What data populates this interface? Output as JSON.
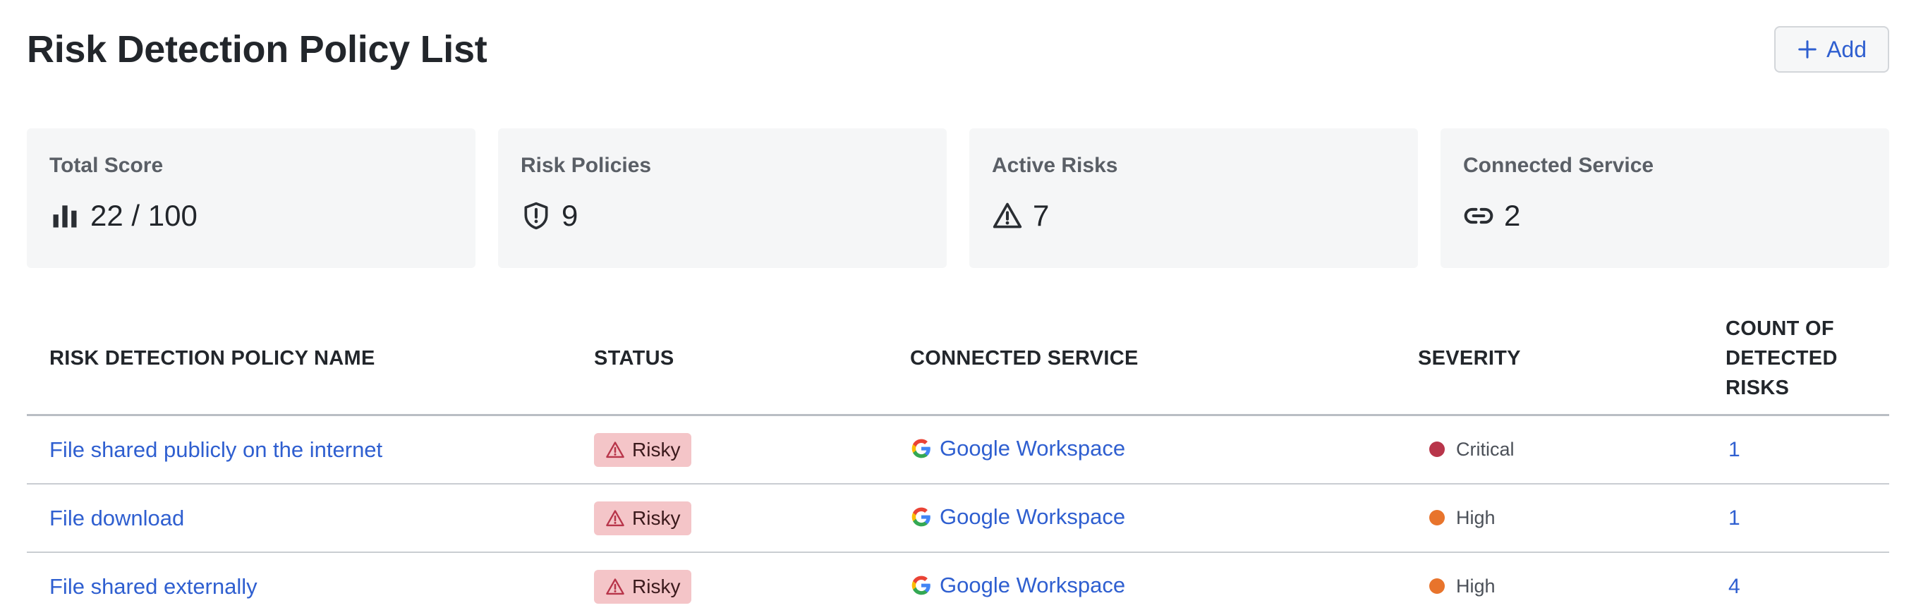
{
  "header": {
    "title": "Risk Detection Policy List",
    "add_label": "Add"
  },
  "cards": [
    {
      "label": "Total Score",
      "value": "22 / 100",
      "icon": "bar-chart-icon"
    },
    {
      "label": "Risk Policies",
      "value": "9",
      "icon": "shield-alert-icon"
    },
    {
      "label": "Active Risks",
      "value": "7",
      "icon": "warning-icon"
    },
    {
      "label": "Connected Service",
      "value": "2",
      "icon": "link-icon"
    }
  ],
  "table": {
    "columns": [
      "RISK DETECTION POLICY NAME",
      "STATUS",
      "CONNECTED SERVICE",
      "SEVERITY",
      "COUNT OF DETECTED RISKS"
    ],
    "rows": [
      {
        "name": "File shared publicly on the internet",
        "status": "Risky",
        "service": "Google Workspace",
        "severity": "Critical",
        "count": "1"
      },
      {
        "name": "File download",
        "status": "Risky",
        "service": "Google Workspace",
        "severity": "High",
        "count": "1"
      },
      {
        "name": "File shared externally",
        "status": "Risky",
        "service": "Google Workspace",
        "severity": "High",
        "count": "4"
      }
    ]
  },
  "colors": {
    "link": "#2f5fd0",
    "risky_badge": "#f4c5c8",
    "critical": "#b8354a",
    "high": "#e8742c"
  }
}
